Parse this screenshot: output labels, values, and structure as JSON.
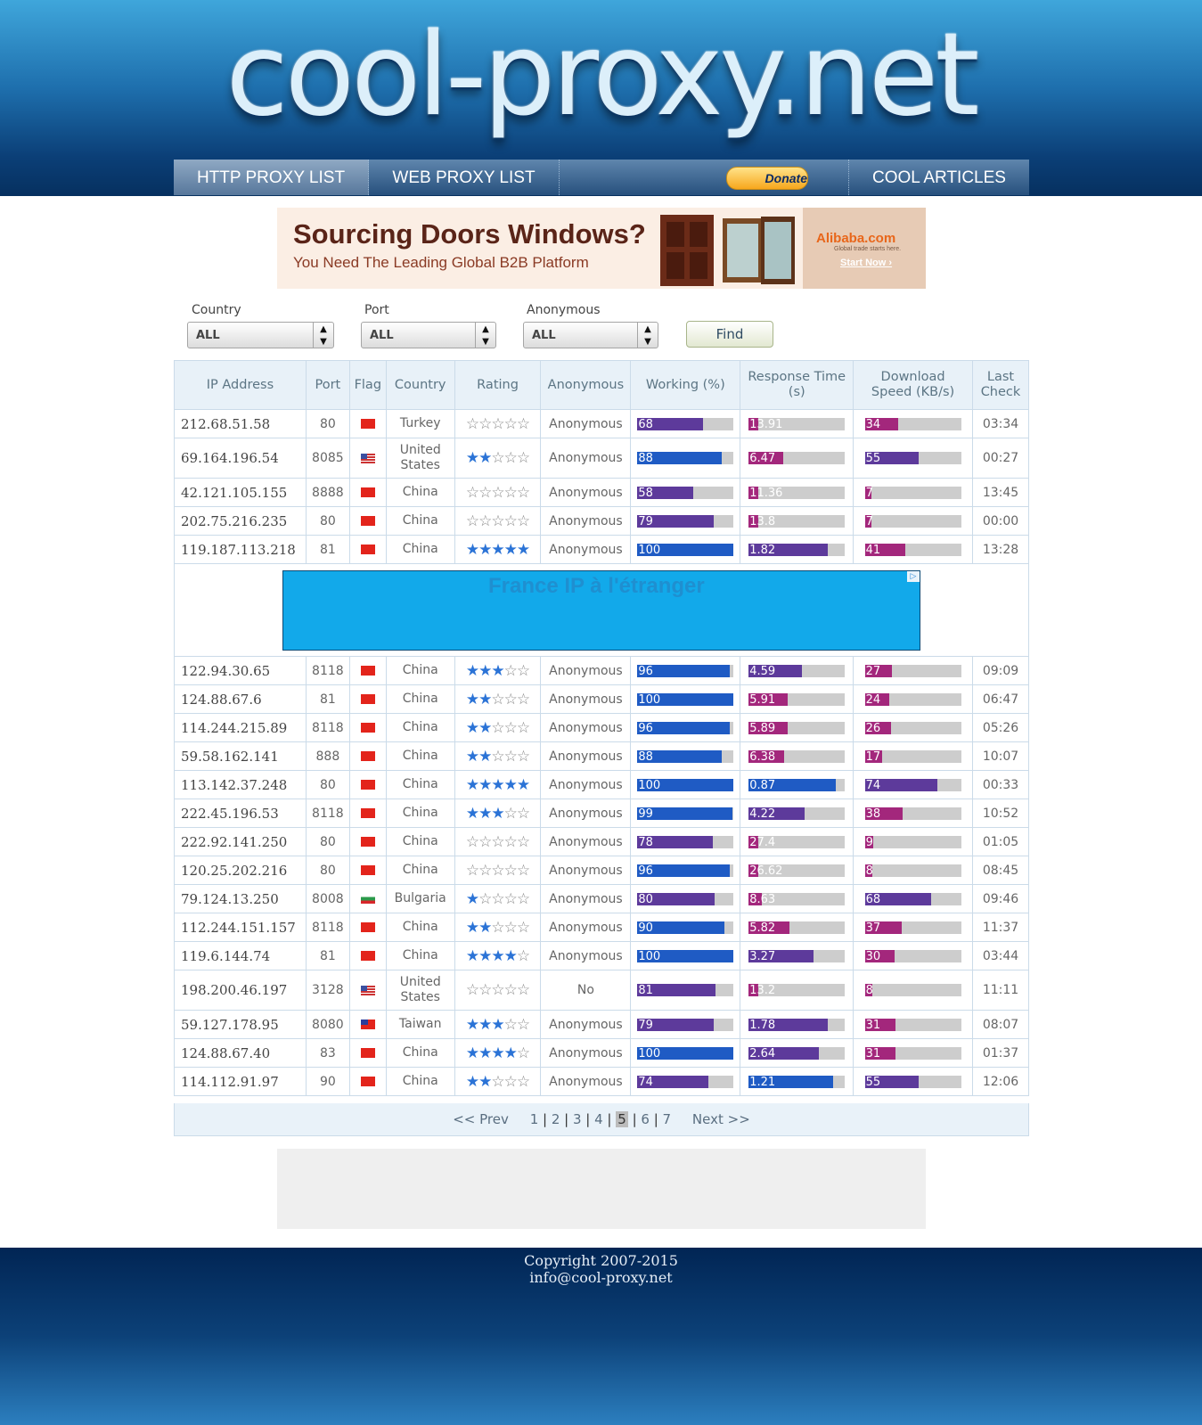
{
  "site": {
    "logo_text": "cool-proxy.net"
  },
  "nav": {
    "http": "HTTP PROXY LIST",
    "web": "WEB PROXY LIST",
    "donate": "Donate",
    "articles": "COOL ARTICLES"
  },
  "ad_top": {
    "headline": "Sourcing Doors  Windows?",
    "sub": "You Need The Leading Global B2B Platform",
    "brand": "Alibaba.com",
    "tag": "Global trade starts here.",
    "cta": "Start Now ›"
  },
  "filters": {
    "country_label": "Country",
    "country_value": "ALL",
    "port_label": "Port",
    "port_value": "ALL",
    "anon_label": "Anonymous",
    "anon_value": "ALL",
    "find": "Find"
  },
  "table": {
    "headers": [
      "IP Address",
      "Port",
      "Flag",
      "Country",
      "Rating",
      "Anonymous",
      "Working (%)",
      "Response Time (s)",
      "Download Speed (KB/s)",
      "Last Check"
    ],
    "rows": [
      {
        "ip": "212.68.51.58",
        "port": "80",
        "flag": "tr",
        "country": "Turkey",
        "rating": 0,
        "anon": "Anonymous",
        "working": 68,
        "resp": "13.91",
        "resp_pct": 0.1,
        "speed": "34",
        "speed_pct": 0.35,
        "check": "03:34"
      },
      {
        "ip": "69.164.196.54",
        "port": "8085",
        "flag": "us",
        "country": "United States",
        "rating": 2,
        "anon": "Anonymous",
        "working": 88,
        "resp": "6.47",
        "resp_pct": 0.36,
        "speed": "55",
        "speed_pct": 0.56,
        "check": "00:27"
      },
      {
        "ip": "42.121.105.155",
        "port": "8888",
        "flag": "cn",
        "country": "China",
        "rating": 0,
        "anon": "Anonymous",
        "working": 58,
        "resp": "11.36",
        "resp_pct": 0.1,
        "speed": "7",
        "speed_pct": 0.07,
        "check": "13:45"
      },
      {
        "ip": "202.75.216.235",
        "port": "80",
        "flag": "cn",
        "country": "China",
        "rating": 0,
        "anon": "Anonymous",
        "working": 79,
        "resp": "13.8",
        "resp_pct": 0.1,
        "speed": "7",
        "speed_pct": 0.07,
        "check": "00:00"
      },
      {
        "ip": "119.187.113.218",
        "port": "81",
        "flag": "cn",
        "country": "China",
        "rating": 5,
        "anon": "Anonymous",
        "working": 100,
        "resp": "1.82",
        "resp_pct": 0.82,
        "speed": "41",
        "speed_pct": 0.42,
        "check": "13:28"
      },
      {
        "ip": "122.94.30.65",
        "port": "8118",
        "flag": "cn",
        "country": "China",
        "rating": 3,
        "anon": "Anonymous",
        "working": 96,
        "resp": "4.59",
        "resp_pct": 0.55,
        "speed": "27",
        "speed_pct": 0.28,
        "check": "09:09"
      },
      {
        "ip": "124.88.67.6",
        "port": "81",
        "flag": "cn",
        "country": "China",
        "rating": 2,
        "anon": "Anonymous",
        "working": 100,
        "resp": "5.91",
        "resp_pct": 0.41,
        "speed": "24",
        "speed_pct": 0.25,
        "check": "06:47"
      },
      {
        "ip": "114.244.215.89",
        "port": "8118",
        "flag": "cn",
        "country": "China",
        "rating": 2,
        "anon": "Anonymous",
        "working": 96,
        "resp": "5.89",
        "resp_pct": 0.41,
        "speed": "26",
        "speed_pct": 0.27,
        "check": "05:26"
      },
      {
        "ip": "59.58.162.141",
        "port": "888",
        "flag": "cn",
        "country": "China",
        "rating": 2,
        "anon": "Anonymous",
        "working": 88,
        "resp": "6.38",
        "resp_pct": 0.37,
        "speed": "17",
        "speed_pct": 0.18,
        "check": "10:07"
      },
      {
        "ip": "113.142.37.248",
        "port": "80",
        "flag": "cn",
        "country": "China",
        "rating": 5,
        "anon": "Anonymous",
        "working": 100,
        "resp": "0.87",
        "resp_pct": 0.91,
        "speed": "74",
        "speed_pct": 0.75,
        "check": "00:33"
      },
      {
        "ip": "222.45.196.53",
        "port": "8118",
        "flag": "cn",
        "country": "China",
        "rating": 3,
        "anon": "Anonymous",
        "working": 99,
        "resp": "4.22",
        "resp_pct": 0.58,
        "speed": "38",
        "speed_pct": 0.39,
        "check": "10:52"
      },
      {
        "ip": "222.92.141.250",
        "port": "80",
        "flag": "cn",
        "country": "China",
        "rating": 0,
        "anon": "Anonymous",
        "working": 78,
        "resp": "27.4",
        "resp_pct": 0.1,
        "speed": "9",
        "speed_pct": 0.09,
        "check": "01:05"
      },
      {
        "ip": "120.25.202.216",
        "port": "80",
        "flag": "cn",
        "country": "China",
        "rating": 0,
        "anon": "Anonymous",
        "working": 96,
        "resp": "26.62",
        "resp_pct": 0.1,
        "speed": "8",
        "speed_pct": 0.08,
        "check": "08:45"
      },
      {
        "ip": "79.124.13.250",
        "port": "8008",
        "flag": "bg",
        "country": "Bulgaria",
        "rating": 1,
        "anon": "Anonymous",
        "working": 80,
        "resp": "8.63",
        "resp_pct": 0.14,
        "speed": "68",
        "speed_pct": 0.69,
        "check": "09:46"
      },
      {
        "ip": "112.244.151.157",
        "port": "8118",
        "flag": "cn",
        "country": "China",
        "rating": 2,
        "anon": "Anonymous",
        "working": 90,
        "resp": "5.82",
        "resp_pct": 0.42,
        "speed": "37",
        "speed_pct": 0.38,
        "check": "11:37"
      },
      {
        "ip": "119.6.144.74",
        "port": "81",
        "flag": "cn",
        "country": "China",
        "rating": 4,
        "anon": "Anonymous",
        "working": 100,
        "resp": "3.27",
        "resp_pct": 0.67,
        "speed": "30",
        "speed_pct": 0.31,
        "check": "03:44"
      },
      {
        "ip": "198.200.46.197",
        "port": "3128",
        "flag": "us",
        "country": "United States",
        "rating": 0,
        "anon": "No",
        "working": 81,
        "resp": "13.2",
        "resp_pct": 0.1,
        "speed": "8",
        "speed_pct": 0.08,
        "check": "11:11"
      },
      {
        "ip": "59.127.178.95",
        "port": "8080",
        "flag": "tw",
        "country": "Taiwan",
        "rating": 3,
        "anon": "Anonymous",
        "working": 79,
        "resp": "1.78",
        "resp_pct": 0.82,
        "speed": "31",
        "speed_pct": 0.32,
        "check": "08:07"
      },
      {
        "ip": "124.88.67.40",
        "port": "83",
        "flag": "cn",
        "country": "China",
        "rating": 4,
        "anon": "Anonymous",
        "working": 100,
        "resp": "2.64",
        "resp_pct": 0.73,
        "speed": "31",
        "speed_pct": 0.32,
        "check": "01:37"
      },
      {
        "ip": "114.112.91.97",
        "port": "90",
        "flag": "cn",
        "country": "China",
        "rating": 2,
        "anon": "Anonymous",
        "working": 74,
        "resp": "1.21",
        "resp_pct": 0.88,
        "speed": "55",
        "speed_pct": 0.56,
        "check": "12:06"
      }
    ]
  },
  "ad_mid": {
    "text": "France IP à l'étranger",
    "badge": "▷"
  },
  "pager": {
    "prev": "<< Prev",
    "pages": [
      "1",
      "2",
      "3",
      "4",
      "5",
      "6",
      "7"
    ],
    "current": "5",
    "next": "Next >>"
  },
  "footer": {
    "copyright": "Copyright 2007-2015",
    "email": "info@cool-proxy.net"
  },
  "colors": {
    "star_on": "#2b73d6",
    "blue": "#1f5bc4",
    "purple": "#5d3a9b",
    "magenta": "#a3277c"
  }
}
